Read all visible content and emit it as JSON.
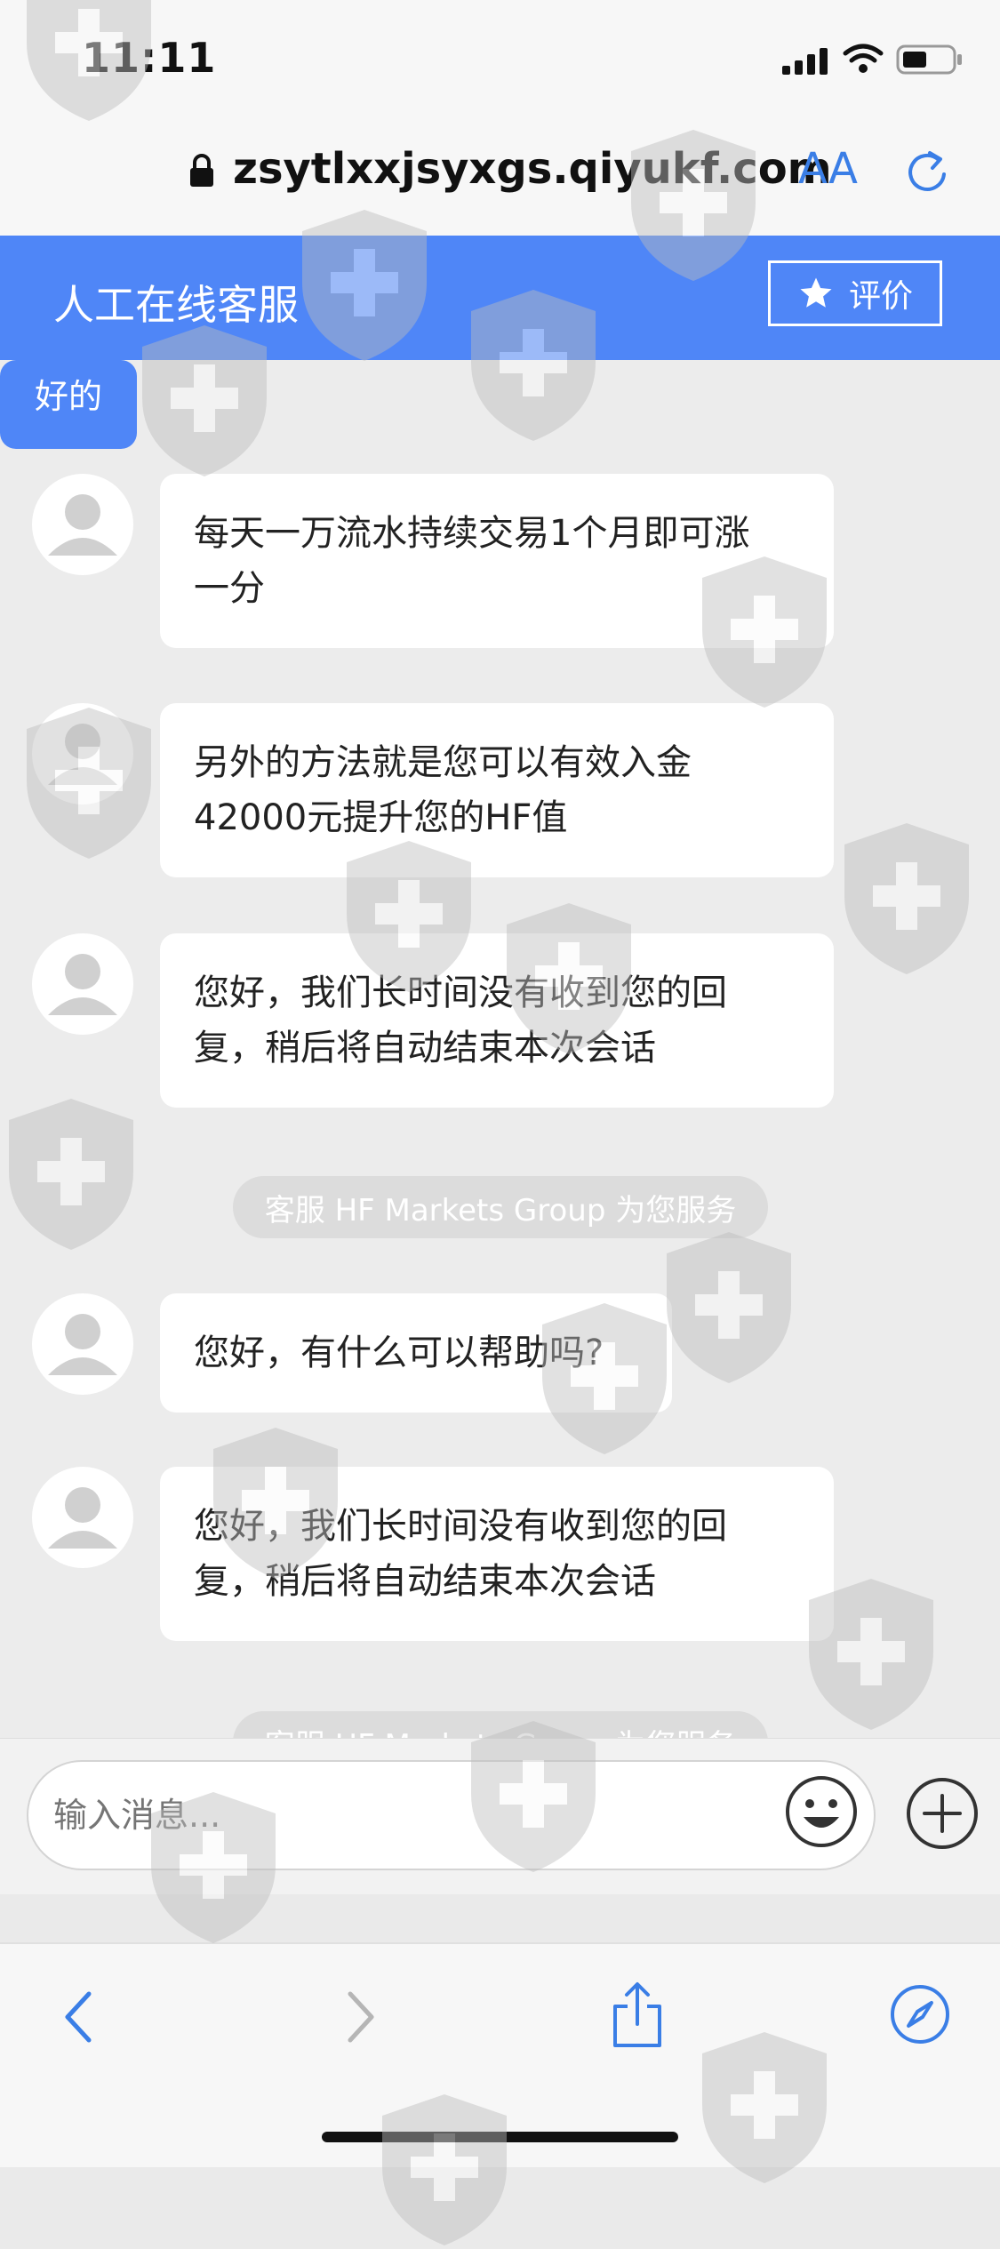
{
  "status_bar": {
    "time": "11:11"
  },
  "browser": {
    "url": "zsytlxxjsyxgs.qiyukf.com",
    "text_size_label": "AA"
  },
  "header": {
    "title": "人工在线客服",
    "rate_label": "评价"
  },
  "messages": {
    "mine_partial": "好的",
    "m1": [
      "每天一万流水持续交易1个月即可涨",
      "一分"
    ],
    "m2": [
      "另外的方法就是您可以有效入金",
      "42000元提升您的HF值"
    ],
    "m3": [
      "您好，我们长时间没有收到您的回",
      "复，稍后将自动结束本次会话"
    ],
    "system1": "客服 HF Markets Group 为您服务",
    "m4": "您好，有什么可以帮助吗?",
    "m5": [
      "您好，我们长时间没有收到您的回",
      "复，稍后将自动结束本次会话"
    ],
    "system2": "客服 HF Markets Group 为您服务"
  },
  "composer": {
    "placeholder": "输入消息..."
  },
  "colors": {
    "accent": "#4f86f7",
    "ios_blue": "#3a7ee6"
  }
}
